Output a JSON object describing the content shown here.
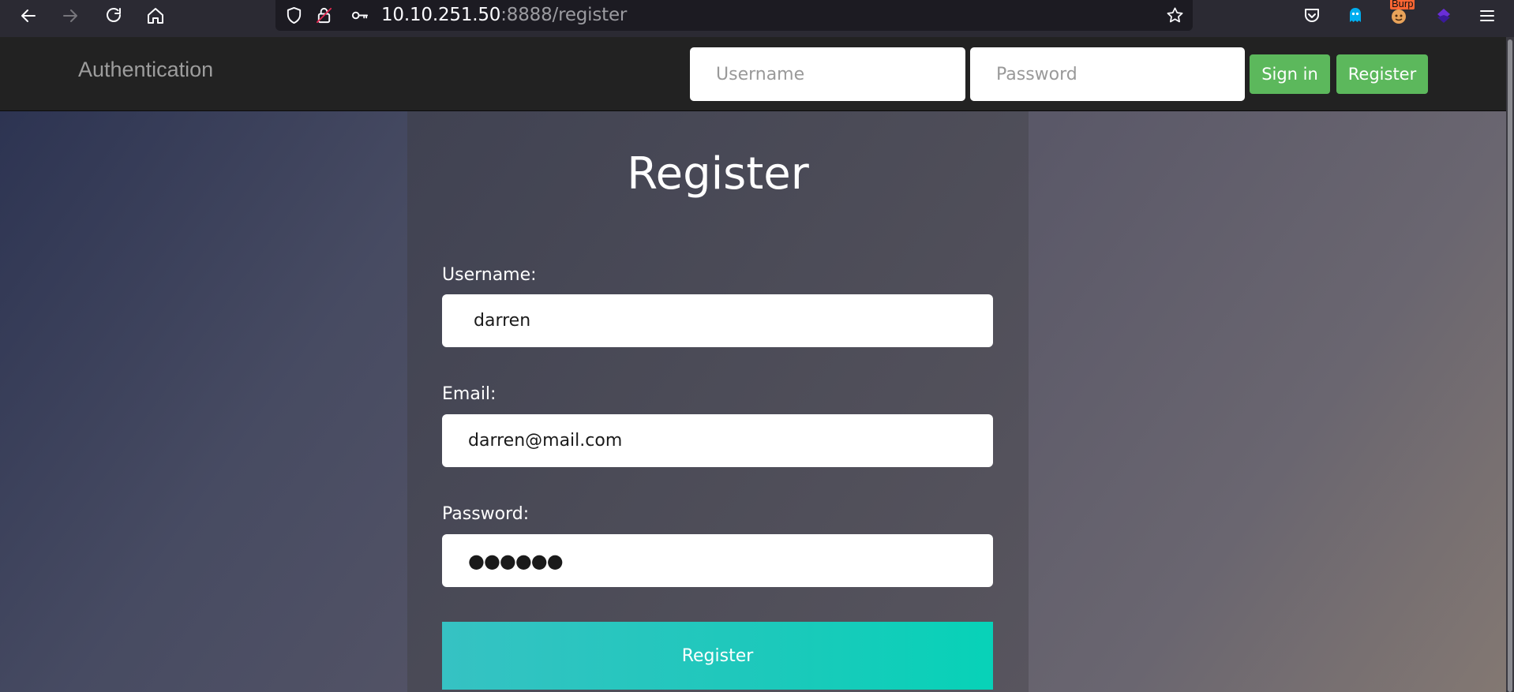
{
  "browser": {
    "url_host": "10.10.251.50",
    "url_path": ":8888/register",
    "burp_badge": "Burp",
    "icons": [
      "back-icon",
      "forward-icon",
      "reload-icon",
      "home-icon",
      "shield-icon",
      "insecure-lock-icon",
      "key-icon",
      "bookmark-star-icon",
      "pocket-icon",
      "ghostery-icon",
      "burp-icon",
      "extension-icon",
      "menu-icon"
    ]
  },
  "navbar": {
    "brand": "Authentication",
    "username_placeholder": "Username",
    "password_placeholder": "Password",
    "signin_label": "Sign in",
    "register_label": "Register"
  },
  "form": {
    "title": "Register",
    "username_label": "Username:",
    "username_value": "darren",
    "email_label": "Email:",
    "email_value": "darren@mail.com",
    "password_label": "Password:",
    "password_value": "●●●●●●",
    "submit_label": "Register"
  },
  "colors": {
    "navbar_bg": "#222222",
    "nav_button": "#5cb85c",
    "submit_gradient_start": "#36c2c3",
    "submit_gradient_end": "#07d2b8",
    "browser_chrome": "#2b2a33"
  }
}
